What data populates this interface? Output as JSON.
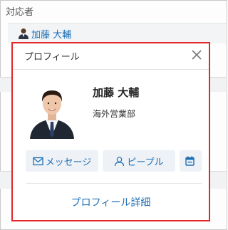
{
  "section": {
    "label": "対応者"
  },
  "assignee": {
    "name": "加藤 大輔",
    "avatar_icon": "user-avatar-icon"
  },
  "popup": {
    "title": "プロフィール",
    "close_icon": "close-icon",
    "person": {
      "name": "加藤 大輔",
      "department": "海外営業部",
      "photo_icon": "profile-photo"
    },
    "actions": {
      "message": {
        "label": "メッセージ",
        "icon": "envelope-icon"
      },
      "people": {
        "label": "ピープル",
        "icon": "person-icon"
      },
      "schedule": {
        "icon": "calendar-icon"
      }
    },
    "details_link": "プロフィール詳細"
  },
  "colors": {
    "accent": "#1f6fb5",
    "highlight_border": "#e3262a",
    "button_bg": "#eef2f6"
  }
}
